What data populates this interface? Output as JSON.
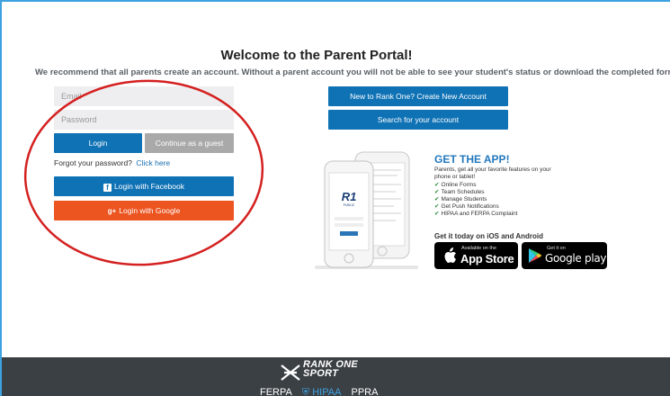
{
  "page": {
    "title": "Welcome to the Parent Portal!",
    "subtitle": "We recommend that all parents create an account. Without a parent account you will not be able to see your student's status or download the completed forms"
  },
  "login_form": {
    "email_placeholder": "Email",
    "password_placeholder": "Password",
    "login_label": "Login",
    "guest_label": "Continue as a guest",
    "forgot_text": "Forgot your password?",
    "forgot_link": "Click here",
    "facebook_label": "Login with Facebook",
    "google_label": "Login with Google"
  },
  "account_actions": {
    "create_label": "New to Rank One? Create New Account",
    "search_label": "Search for your account"
  },
  "app_promo": {
    "title": "GET THE APP!",
    "description": "Parents, get all your favorite features on your phone or tablet!",
    "features": [
      "Online Forms",
      "Team Schedules",
      "Manage Students",
      "Get Push Notifications",
      "HIPAA and FERPA Complaint"
    ],
    "cta": "Get it today on iOS and Android",
    "app_store_small": "Available on the",
    "app_store_big": "App Store",
    "google_play_small": "Get it on",
    "google_play_big": "Google play"
  },
  "footer": {
    "brand_line1": "RANK ONE",
    "brand_line2": "SPORT",
    "links": [
      "FERPA",
      "HIPAA",
      "PPRA"
    ]
  },
  "colors": {
    "primary": "#0f72b5",
    "guest": "#a9a9a9",
    "google": "#ec5420",
    "footer": "#3b4045",
    "annotation": "#d42020"
  }
}
